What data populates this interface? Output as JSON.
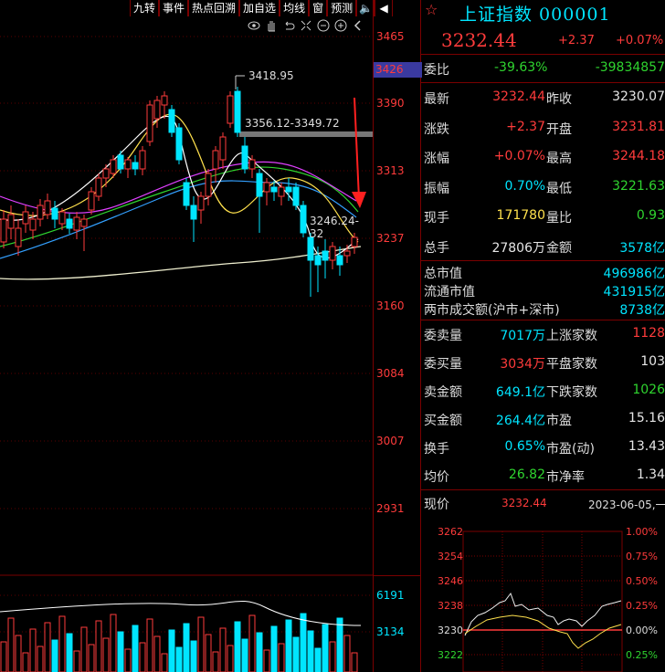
{
  "toolbar": {
    "items": [
      "九转",
      "事件",
      "热点回溯",
      "加自选",
      "均线",
      "窗",
      "预测"
    ]
  },
  "price_axis": {
    "labels": [
      "3465",
      "3390",
      "3313",
      "3237",
      "3160",
      "3084",
      "3007",
      "2931"
    ],
    "highlight": "3426",
    "volume_labels": [
      "6191",
      "3134"
    ]
  },
  "annotations": {
    "high": "3418.95",
    "gap": "3356.12-3349.72",
    "low_gap": "3246.24-32"
  },
  "header": {
    "title": "上证指数 000001",
    "price": "3232.44",
    "change": "+2.37",
    "change_pct": "+0.07%"
  },
  "weibi": {
    "label": "委比",
    "pct": "-39.63%",
    "diff": "-39834857"
  },
  "quote_rows": [
    {
      "k1": "最新",
      "v1": "3232.44",
      "c1": "red",
      "k2": "昨收",
      "v2": "3230.07",
      "c2": "white"
    },
    {
      "k1": "涨跌",
      "v1": "+2.37",
      "c1": "red",
      "k2": "开盘",
      "v2": "3231.81",
      "c2": "red"
    },
    {
      "k1": "涨幅",
      "v1": "+0.07%",
      "c1": "red",
      "k2": "最高",
      "v2": "3244.18",
      "c2": "red"
    },
    {
      "k1": "振幅",
      "v1": "0.70%",
      "c1": "cyan",
      "k2": "最低",
      "v2": "3221.63",
      "c2": "green"
    },
    {
      "k1": "现手",
      "v1": "171780",
      "c1": "yellow",
      "k2": "量比",
      "v2": "0.93",
      "c2": "green"
    },
    {
      "k1": "总手",
      "v1": "27806万",
      "c1": "white",
      "k2": "金额",
      "v2": "3578亿",
      "c2": "cyan"
    }
  ],
  "market": [
    {
      "k": "总市值",
      "v": "496986亿"
    },
    {
      "k": "流通市值",
      "v": "431915亿"
    },
    {
      "k": "两市成交额(沪市+深市)",
      "v": "8738亿"
    }
  ],
  "breadth_rows": [
    {
      "k1": "委卖量",
      "v1": "7017万",
      "c1": "cyan",
      "k2": "上涨家数",
      "v2": "1128",
      "c2": "red"
    },
    {
      "k1": "委买量",
      "v1": "3034万",
      "c1": "red",
      "k2": "平盘家数",
      "v2": "103",
      "c2": "white"
    },
    {
      "k1": "卖金额",
      "v1": "649.1亿",
      "c1": "cyan",
      "k2": "下跌家数",
      "v2": "1026",
      "c2": "green"
    },
    {
      "k1": "买金额",
      "v1": "264.4亿",
      "c1": "cyan",
      "k2": "市盈",
      "v2": "15.16",
      "c2": "white"
    },
    {
      "k1": "换手",
      "v1": "0.65%",
      "c1": "cyan",
      "k2": "市盈(动)",
      "v2": "13.43",
      "c2": "white"
    },
    {
      "k1": "均价",
      "v1": "26.82",
      "c1": "green",
      "k2": "市净率",
      "v2": "1.34",
      "c2": "white"
    }
  ],
  "intraday": {
    "label": "现价",
    "price": "3232.44",
    "date": "2023-06-05,一",
    "left_axis": [
      "3262",
      "3254",
      "3246",
      "3238",
      "3230",
      "3222"
    ],
    "right_axis": [
      "1.00%",
      "0.75%",
      "0.50%",
      "0.25%",
      "0.00%",
      "0.25%"
    ]
  },
  "colors": {
    "up": "#ff3b3b",
    "down": "#00e5ff",
    "grid": "#7a0000",
    "title": "#00e5ff"
  }
}
